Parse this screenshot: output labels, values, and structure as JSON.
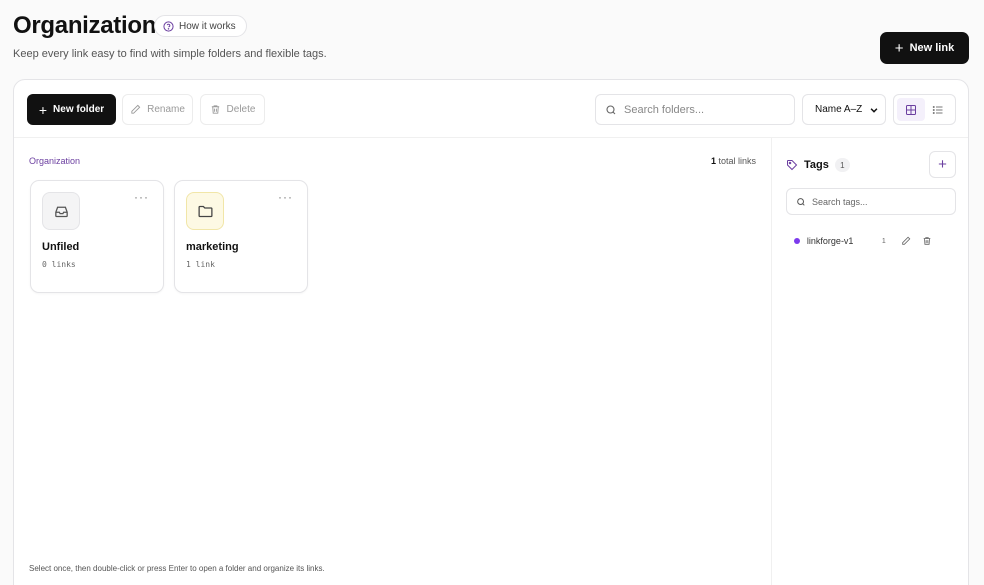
{
  "header": {
    "title": "Organization",
    "how_it_works": "How it works",
    "subtitle": "Keep every link easy to find with simple folders and flexible tags.",
    "new_link": "New link"
  },
  "toolbar": {
    "new_folder": "New folder",
    "rename": "Rename",
    "delete": "Delete",
    "search_placeholder": "Search folders...",
    "sort_value": "Name A–Z"
  },
  "main": {
    "breadcrumb": "Organization",
    "total_count": "1",
    "total_suffix": "total links",
    "folders": [
      {
        "name": "Unfiled",
        "count": "0 links",
        "icon": "inbox-icon"
      },
      {
        "name": "marketing",
        "count": "1 link",
        "icon": "folder-icon"
      }
    ],
    "hint": "Select once, then double-click or press Enter to open a folder and organize its links."
  },
  "tags": {
    "title": "Tags",
    "count": "1",
    "search_placeholder": "Search tags...",
    "items": [
      {
        "name": "linkforge-v1",
        "count": "1",
        "color": "#7c3aed"
      }
    ]
  },
  "colors": {
    "accent": "#6b3fa0",
    "primary_button": "#111111",
    "folder_highlight": "#fdf9e4"
  }
}
